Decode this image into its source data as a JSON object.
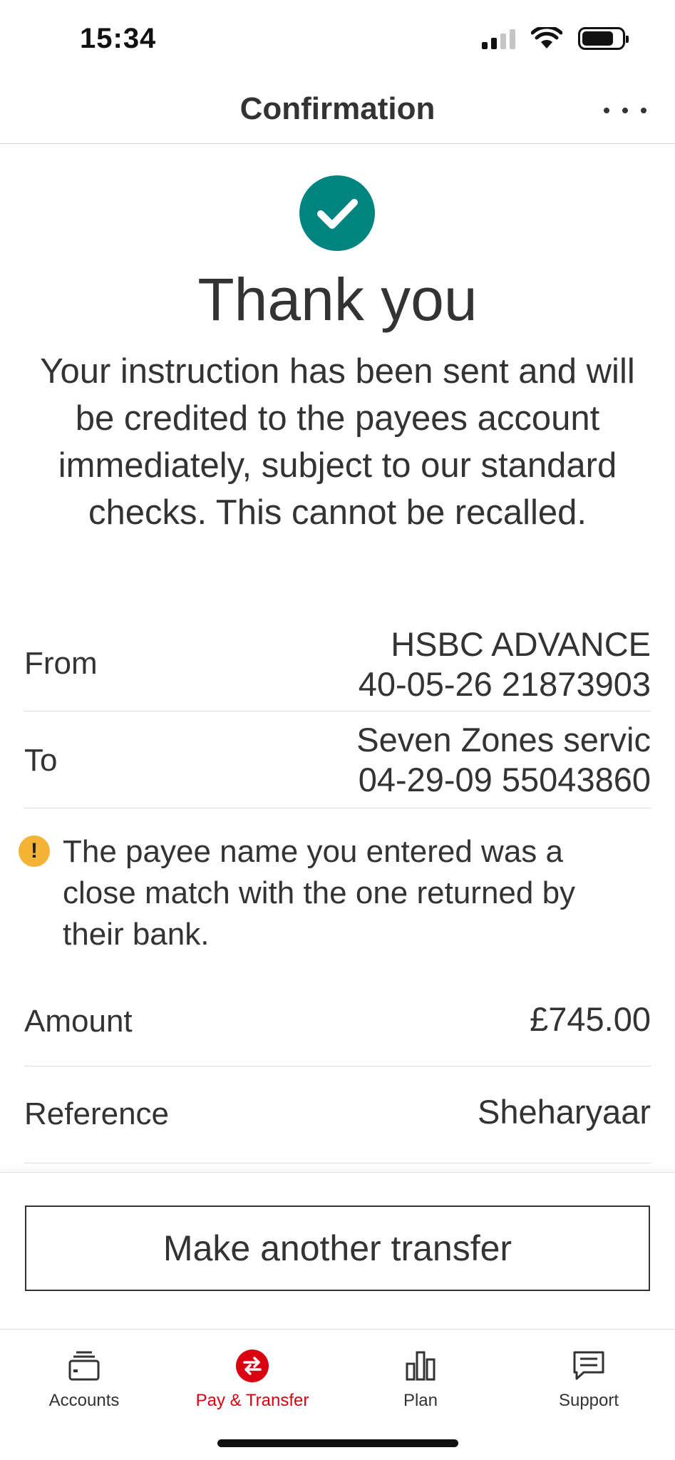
{
  "status_bar": {
    "time": "15:34"
  },
  "header": {
    "title": "Confirmation",
    "more_icon": "more-horizontal-icon"
  },
  "success": {
    "icon": "check-circle-icon",
    "title": "Thank you",
    "message": "Your instruction has been sent and will be credited to the payees account immediately, subject to our standard checks.  This cannot be recalled."
  },
  "details": {
    "from": {
      "label": "From",
      "account_name": "HSBC ADVANCE",
      "account_number": "40-05-26 21873903"
    },
    "to": {
      "label": "To",
      "payee_name": "Seven Zones servic",
      "account_number": "04-29-09 55043860"
    },
    "warning": {
      "icon": "exclamation-circle-icon",
      "text": "The payee name you entered was a close match with the one returned by their bank."
    },
    "amount": {
      "label": "Amount",
      "value": "£745.00"
    },
    "reference": {
      "label": "Reference",
      "value": "Sheharyaar"
    }
  },
  "actions": {
    "make_another_transfer": "Make another transfer"
  },
  "tab_bar": {
    "active_color": "#db0011",
    "items": [
      {
        "label": "Accounts",
        "icon": "wallet-icon"
      },
      {
        "label": "Pay & Transfer",
        "icon": "transfer-arrows-icon"
      },
      {
        "label": "Plan",
        "icon": "bar-chart-icon"
      },
      {
        "label": "Support",
        "icon": "chat-bubble-icon"
      }
    ]
  },
  "colors": {
    "success": "#00847f",
    "warning": "#f5b335",
    "brand_red": "#db0011",
    "text": "#333333"
  }
}
